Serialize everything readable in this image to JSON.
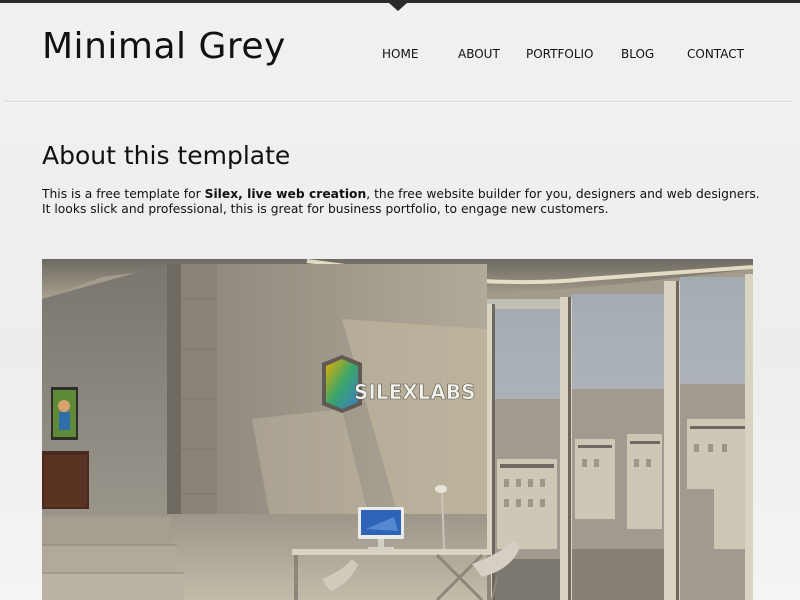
{
  "header": {
    "site_title": "Minimal Grey"
  },
  "nav": {
    "items": [
      {
        "label": "HOME"
      },
      {
        "label": "ABOUT"
      },
      {
        "label": "PORTFOLIO"
      },
      {
        "label": "BLOG"
      },
      {
        "label": "CONTACT"
      }
    ]
  },
  "main": {
    "heading": "About this template",
    "intro_prefix": "This is a free template for ",
    "intro_bold": "Silex, live web creation",
    "intro_suffix": ", the free website builder for you, designers and web designers.",
    "intro_line2": "It looks slick and professional, this is great for business portfolio, to engage new customers.",
    "hero_logo_text": "SILEXLABS"
  },
  "colors": {
    "background": "#efefef",
    "topbar": "#2b2b2b",
    "text": "#111111",
    "divider": "#d6d6d6"
  }
}
